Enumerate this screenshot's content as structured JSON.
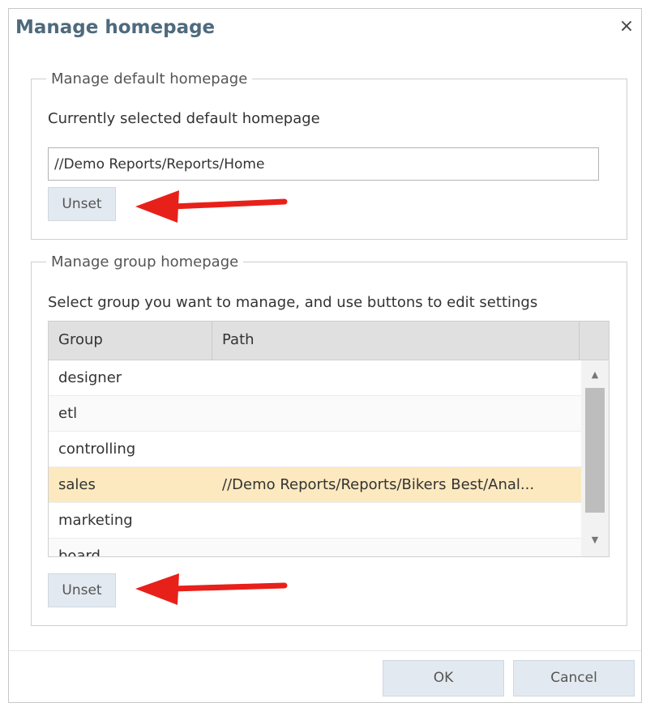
{
  "dialog": {
    "title": "Manage homepage",
    "close_label": "×"
  },
  "default_section": {
    "legend": "Manage default homepage",
    "current_label": "Currently selected default homepage",
    "current_value": "//Demo Reports/Reports/Home",
    "unset_label": "Unset"
  },
  "group_section": {
    "legend": "Manage group homepage",
    "instruction": "Select group you want to manage, and use buttons to edit settings",
    "columns": {
      "group": "Group",
      "path": "Path"
    },
    "rows": [
      {
        "group": "designer",
        "path": ""
      },
      {
        "group": "etl",
        "path": ""
      },
      {
        "group": "controlling",
        "path": ""
      },
      {
        "group": "sales",
        "path": "//Demo Reports/Reports/Bikers Best/Anal...",
        "selected": true
      },
      {
        "group": "marketing",
        "path": ""
      },
      {
        "group": "board",
        "path": ""
      }
    ],
    "unset_label": "Unset"
  },
  "footer": {
    "ok_label": "OK",
    "cancel_label": "Cancel"
  },
  "colors": {
    "title": "#4e6a7e",
    "selected_row": "#fde9bf",
    "button_bg": "#e3e9f0",
    "annotation_arrow": "#e8201a"
  },
  "icons": {
    "close": "close-icon",
    "scroll_up": "scroll-up-icon",
    "scroll_down": "scroll-down-icon",
    "annotation": "red-arrow-icon"
  }
}
